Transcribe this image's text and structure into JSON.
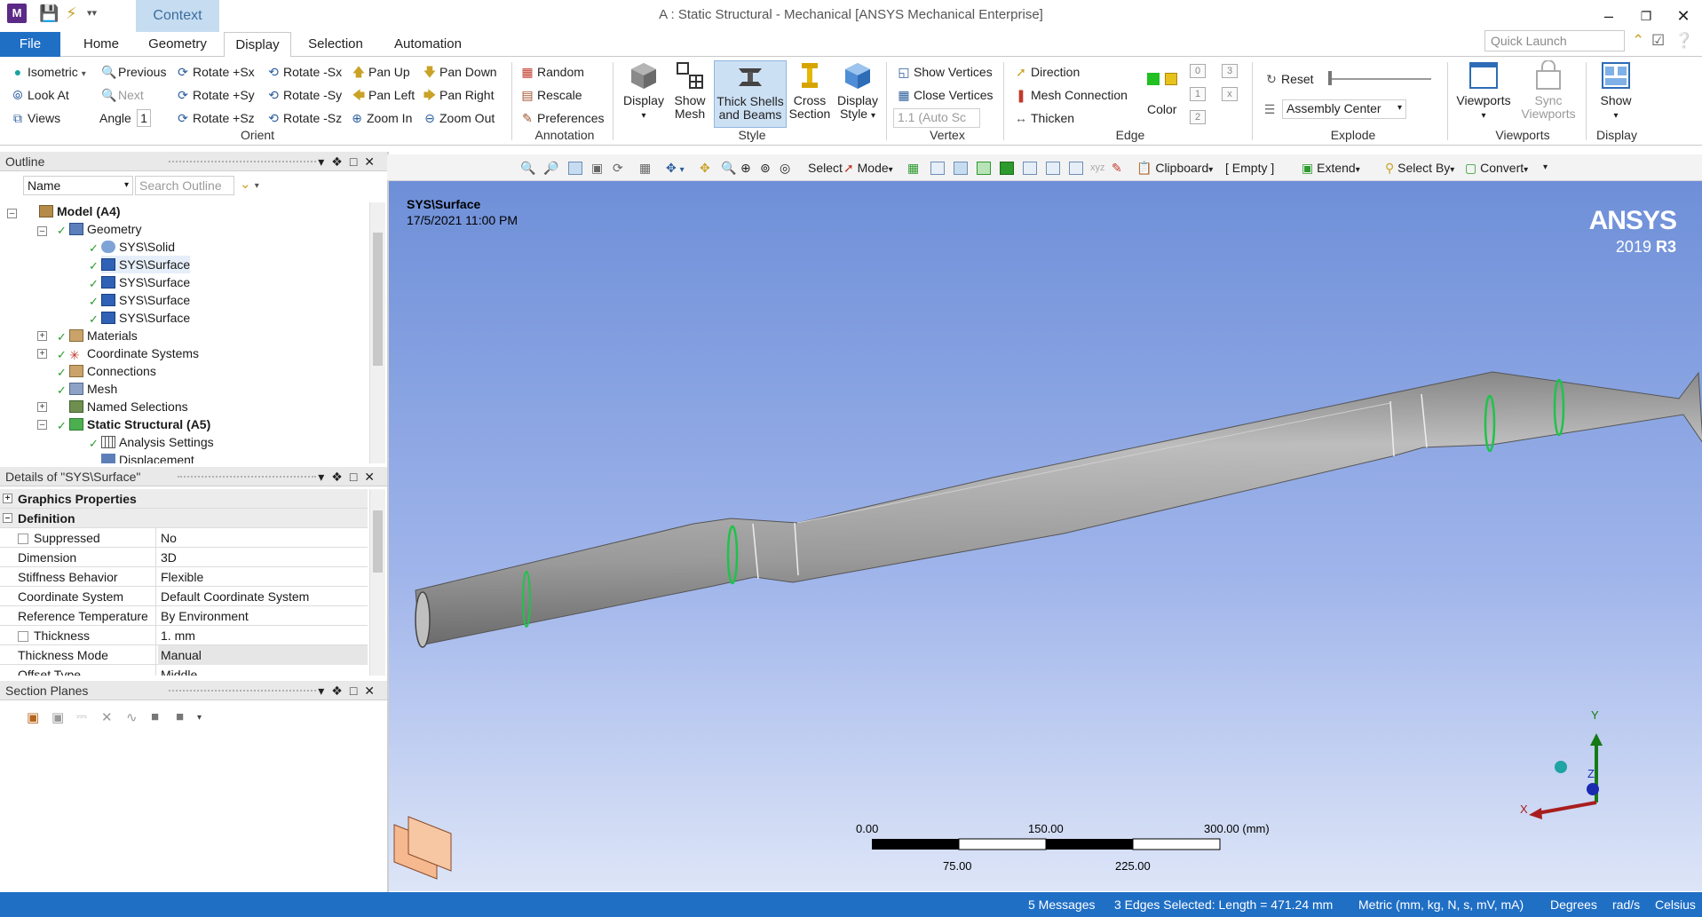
{
  "window": {
    "title": "A : Static Structural - Mechanical [ANSYS Mechanical Enterprise]",
    "app_icon": "M",
    "context_tab": "Context"
  },
  "tabs": [
    "File",
    "Home",
    "Geometry",
    "Display",
    "Selection",
    "Automation"
  ],
  "active_tab": "Display",
  "quick_launch": {
    "placeholder": "Quick Launch"
  },
  "ribbon": {
    "orient": {
      "label": "Orient",
      "isometric": "Isometric",
      "previous": "Previous",
      "next": "Next",
      "look_at": "Look At",
      "views": "Views",
      "angle_label": "Angle",
      "angle_value": "1",
      "rotate_px": "Rotate +Sx",
      "rotate_nx": "Rotate -Sx",
      "rotate_py": "Rotate +Sy",
      "rotate_ny": "Rotate -Sy",
      "rotate_pz": "Rotate +Sz",
      "rotate_nz": "Rotate -Sz",
      "pan_up": "Pan Up",
      "pan_down": "Pan Down",
      "pan_left": "Pan Left",
      "pan_right": "Pan Right",
      "zoom_in": "Zoom In",
      "zoom_out": "Zoom Out"
    },
    "annotation": {
      "label": "Annotation",
      "random": "Random",
      "rescale": "Rescale",
      "preferences": "Preferences"
    },
    "style": {
      "label": "Style",
      "display": "Display",
      "show_mesh_1": "Show",
      "show_mesh_2": "Mesh",
      "thick_1": "Thick Shells",
      "thick_2": "and Beams",
      "cross_1": "Cross",
      "cross_2": "Section",
      "dstyle_1": "Display",
      "dstyle_2": "Style"
    },
    "vertex": {
      "label": "Vertex",
      "show_vertices": "Show Vertices",
      "close_vertices": "Close Vertices",
      "auto_value": "1.1 (Auto Sc"
    },
    "edge": {
      "label": "Edge",
      "direction": "Direction",
      "mesh_connection": "Mesh Connection",
      "thicken": "Thicken",
      "color": "Color"
    },
    "explode": {
      "label": "Explode",
      "reset": "Reset",
      "assembly_center": "Assembly Center"
    },
    "viewports": {
      "label": "Viewports",
      "viewports": "Viewports",
      "sync_1": "Sync",
      "sync_2": "Viewports"
    },
    "display": {
      "label": "Display",
      "show": "Show"
    }
  },
  "outline": {
    "title": "Outline",
    "filter": "Name",
    "search_placeholder": "Search Outline",
    "tree": [
      {
        "label": "Model (A4)",
        "bold": true
      },
      {
        "label": "Geometry"
      },
      {
        "label": "SYS\\Solid"
      },
      {
        "label": "SYS\\Surface",
        "selected": true
      },
      {
        "label": "SYS\\Surface"
      },
      {
        "label": "SYS\\Surface"
      },
      {
        "label": "SYS\\Surface"
      },
      {
        "label": "Materials"
      },
      {
        "label": "Coordinate Systems"
      },
      {
        "label": "Connections"
      },
      {
        "label": "Mesh"
      },
      {
        "label": "Named Selections"
      },
      {
        "label": "Static Structural (A5)",
        "bold": true
      },
      {
        "label": "Analysis Settings"
      },
      {
        "label": "Displacement"
      }
    ]
  },
  "details": {
    "title": "Details of \"SYS\\Surface\"",
    "sections": {
      "graphics": "Graphics Properties",
      "definition": "Definition"
    },
    "rows": [
      {
        "key": "Suppressed",
        "value": "No",
        "checkbox": true
      },
      {
        "key": "Dimension",
        "value": "3D"
      },
      {
        "key": "Stiffness Behavior",
        "value": "Flexible"
      },
      {
        "key": "Coordinate System",
        "value": "Default Coordinate System"
      },
      {
        "key": "Reference Temperature",
        "value": "By Environment"
      },
      {
        "key": "Thickness",
        "value": "1. mm",
        "checkbox": true
      },
      {
        "key": "Thickness Mode",
        "value": "Manual"
      },
      {
        "key": "Offset Type",
        "value": "Middle"
      }
    ]
  },
  "section_planes": {
    "title": "Section Planes"
  },
  "gfx_toolbar": {
    "select": "Select",
    "mode": "Mode",
    "clipboard": "Clipboard",
    "empty": "[ Empty ]",
    "extend": "Extend",
    "select_by": "Select By",
    "convert": "Convert"
  },
  "viewport": {
    "object_name": "SYS\\Surface",
    "timestamp": "17/5/2021 11:00 PM",
    "logo": "ANSYS",
    "version": "2019",
    "release": "R3",
    "scale": {
      "labels_top": [
        "0.00",
        "150.00",
        "300.00 (mm)"
      ],
      "labels_bottom": [
        "75.00",
        "225.00"
      ]
    },
    "triad": {
      "x": "X",
      "y": "Y",
      "z": "Z"
    }
  },
  "status": {
    "messages": "5 Messages",
    "selection": "3 Edges Selected: Length = 471.24 mm",
    "units": "Metric (mm, kg, N, s, mV, mA)",
    "angle": "Degrees",
    "rate": "rad/s",
    "temp": "Celsius"
  },
  "colors": {
    "accent": "#1f6fc5",
    "context": "#c6dcf0",
    "selected_edge": "#1ec34a",
    "shaft": "#a9a9a9"
  }
}
